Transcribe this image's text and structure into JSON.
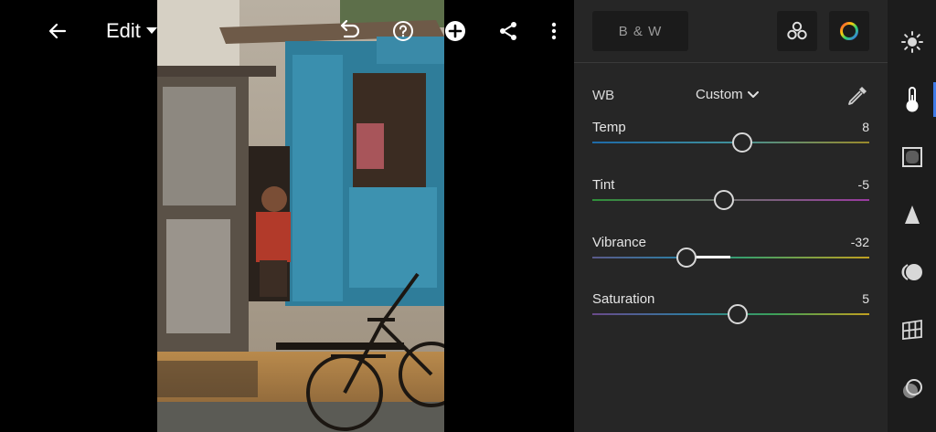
{
  "toolbar": {
    "edit_label": "Edit"
  },
  "panel": {
    "bw_label": "B & W",
    "wb": {
      "label": "WB",
      "value": "Custom"
    },
    "sliders": [
      {
        "label": "Temp",
        "value": "8",
        "position": 0.54
      },
      {
        "label": "Tint",
        "value": "-5",
        "position": 0.475
      },
      {
        "label": "Vibrance",
        "value": "-32",
        "position": 0.34
      },
      {
        "label": "Saturation",
        "value": "5",
        "position": 0.525
      }
    ]
  },
  "rail": {
    "items": [
      "light-icon",
      "color-icon",
      "effects-icon",
      "detail-icon",
      "optics-icon",
      "geometry-icon",
      "presets-icon"
    ],
    "active": "color-icon",
    "accent": "#3f7be8"
  },
  "colors": {
    "panel": "#262626",
    "rail": "#1c1c1c",
    "background": "#000000"
  }
}
